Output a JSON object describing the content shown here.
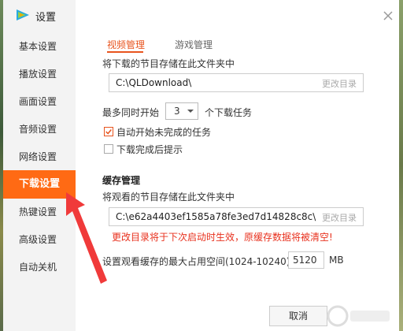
{
  "window": {
    "title": "设置",
    "close_icon": "close-icon",
    "logo_icon": "tencent-video-logo-icon"
  },
  "sidebar": {
    "items": [
      {
        "label": "基本设置"
      },
      {
        "label": "播放设置"
      },
      {
        "label": "画面设置"
      },
      {
        "label": "音频设置"
      },
      {
        "label": "网络设置"
      },
      {
        "label": "下载设置",
        "active": true
      },
      {
        "label": "热键设置"
      },
      {
        "label": "高级设置"
      },
      {
        "label": "自动关机"
      }
    ]
  },
  "tabs": [
    {
      "label": "视频管理",
      "active": true
    },
    {
      "label": "游戏管理",
      "active": false
    }
  ],
  "download": {
    "folder_label": "将下载的节目存储在此文件夹中",
    "folder_path": "C:\\QLDownload\\",
    "change_dir": "更改目录",
    "max_concurrent_prefix": "最多同时开始",
    "max_concurrent_value": "3",
    "max_concurrent_suffix": "个下载任务",
    "auto_start_label": "自动开始未完成的任务",
    "auto_start_checked": true,
    "prompt_label": "下载完成后提示",
    "prompt_checked": false
  },
  "cache": {
    "section_title": "缓存管理",
    "folder_label": "将观看的节目存储在此文件夹中",
    "folder_path": "C:\\e62a4403ef1585a78fe3ed7d14828c8c\\",
    "change_dir": "更改目录",
    "warning": "更改目录将于下次启动时生效，原缓存数据将被清空!",
    "max_space_label": "设置观看缓存的最大占用空间(1024-10240)",
    "max_space_value": "5120",
    "max_space_unit": "MB"
  },
  "footer": {
    "cancel_label": "取消"
  },
  "colors": {
    "accent": "#ff6a14",
    "tab_active": "#e8541e",
    "warning": "#e8311e",
    "arrow": "#f03a3a"
  }
}
